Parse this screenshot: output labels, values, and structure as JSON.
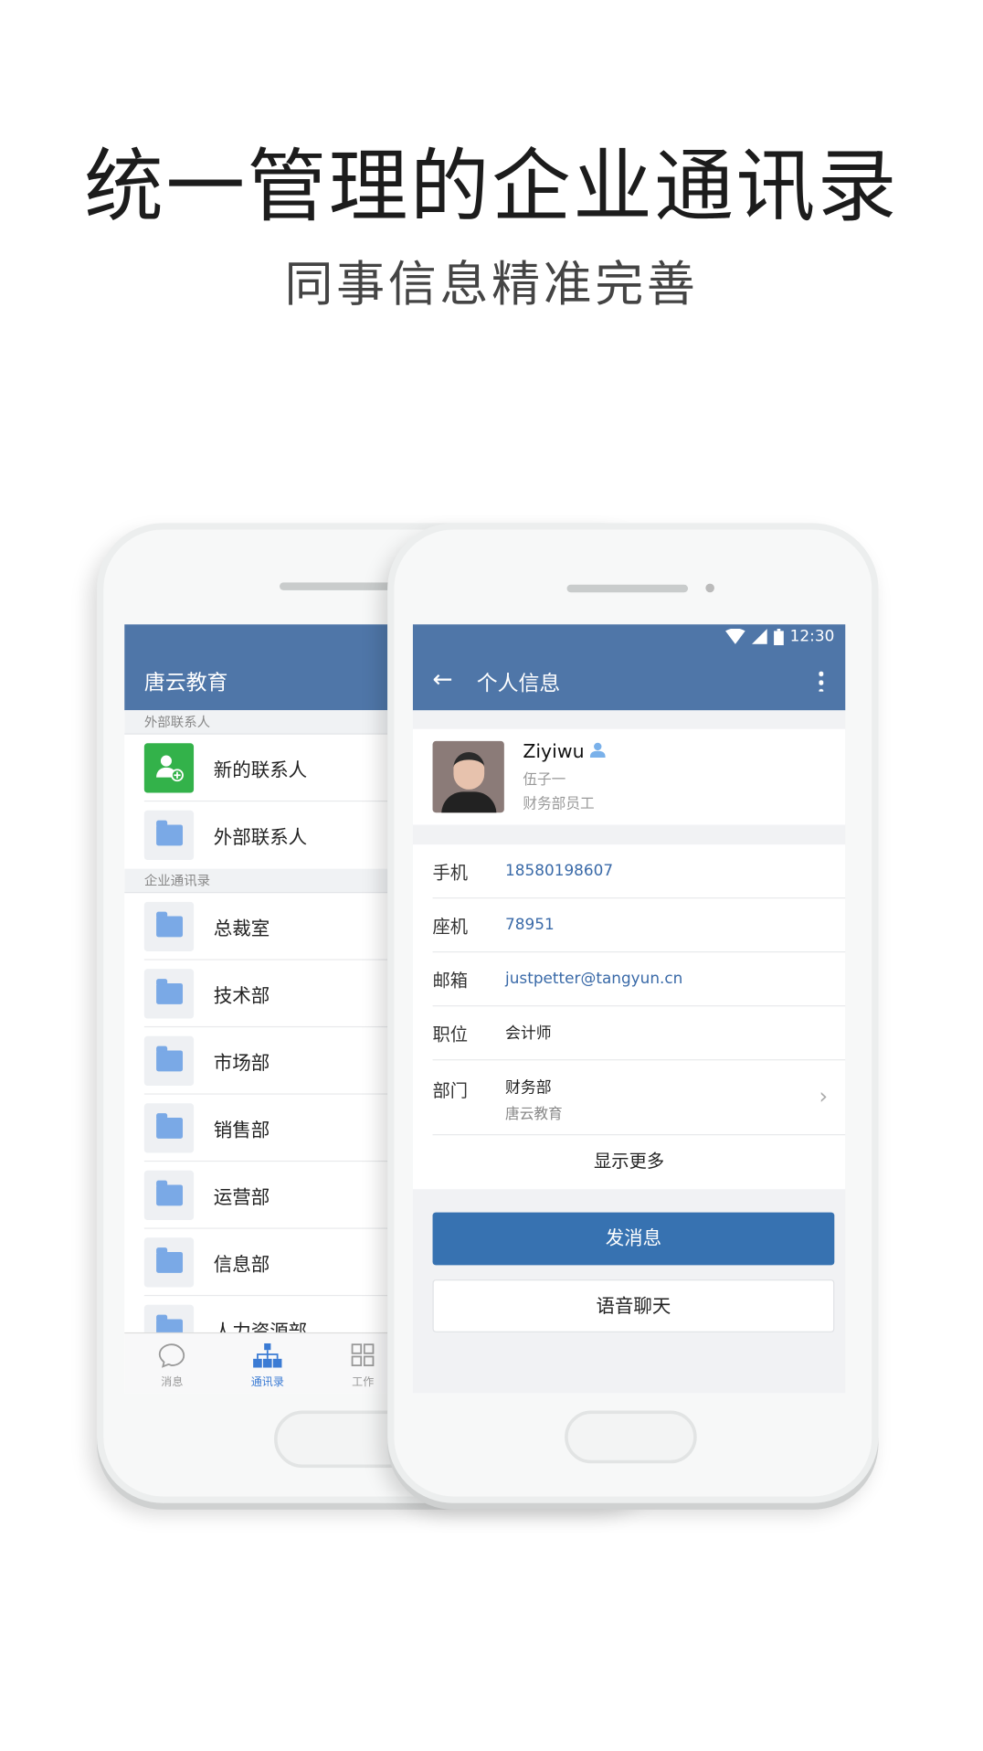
{
  "headline": {
    "title": "统一管理的企业通讯录",
    "subtitle": "同事信息精准完善"
  },
  "back_phone": {
    "header_title": "唐云教育",
    "sections": [
      {
        "label": "外部联系人",
        "items": [
          {
            "label": "新的联系人",
            "icon": "add-contact-icon"
          },
          {
            "label": "外部联系人",
            "icon": "folder-icon"
          }
        ]
      },
      {
        "label": "企业通讯录",
        "items": [
          {
            "label": "总裁室"
          },
          {
            "label": "技术部"
          },
          {
            "label": "市场部"
          },
          {
            "label": "销售部"
          },
          {
            "label": "运营部"
          },
          {
            "label": "信息部"
          },
          {
            "label": "人力资源部"
          }
        ]
      }
    ],
    "tabs": [
      {
        "label": "消息",
        "icon": "chat-bubble-icon"
      },
      {
        "label": "通讯录",
        "icon": "org-chart-icon",
        "active": true
      },
      {
        "label": "工作",
        "icon": "grid-icon"
      }
    ]
  },
  "front_phone": {
    "status": {
      "time": "12:30"
    },
    "header_title": "个人信息",
    "profile": {
      "name": "Ziyiwu",
      "chinese_name": "伍子一",
      "role": "财务部员工"
    },
    "fields": [
      {
        "label": "手机",
        "value": "18580198607"
      },
      {
        "label": "座机",
        "value": "78951"
      },
      {
        "label": "邮箱",
        "value": "justpetter@tangyun.cn"
      },
      {
        "label": "职位",
        "value": "会计师"
      },
      {
        "label": "部门",
        "value": "财务部",
        "sub": "唐云教育"
      }
    ],
    "show_more": "显示更多",
    "send_message": "发消息",
    "voice_chat": "语音聊天"
  },
  "colors": {
    "header": "#4f76a8",
    "primary_button": "#3772b1",
    "add_contact": "#33b24a",
    "folder": "#7aa9e6",
    "tab_active": "#3b7bd4"
  }
}
